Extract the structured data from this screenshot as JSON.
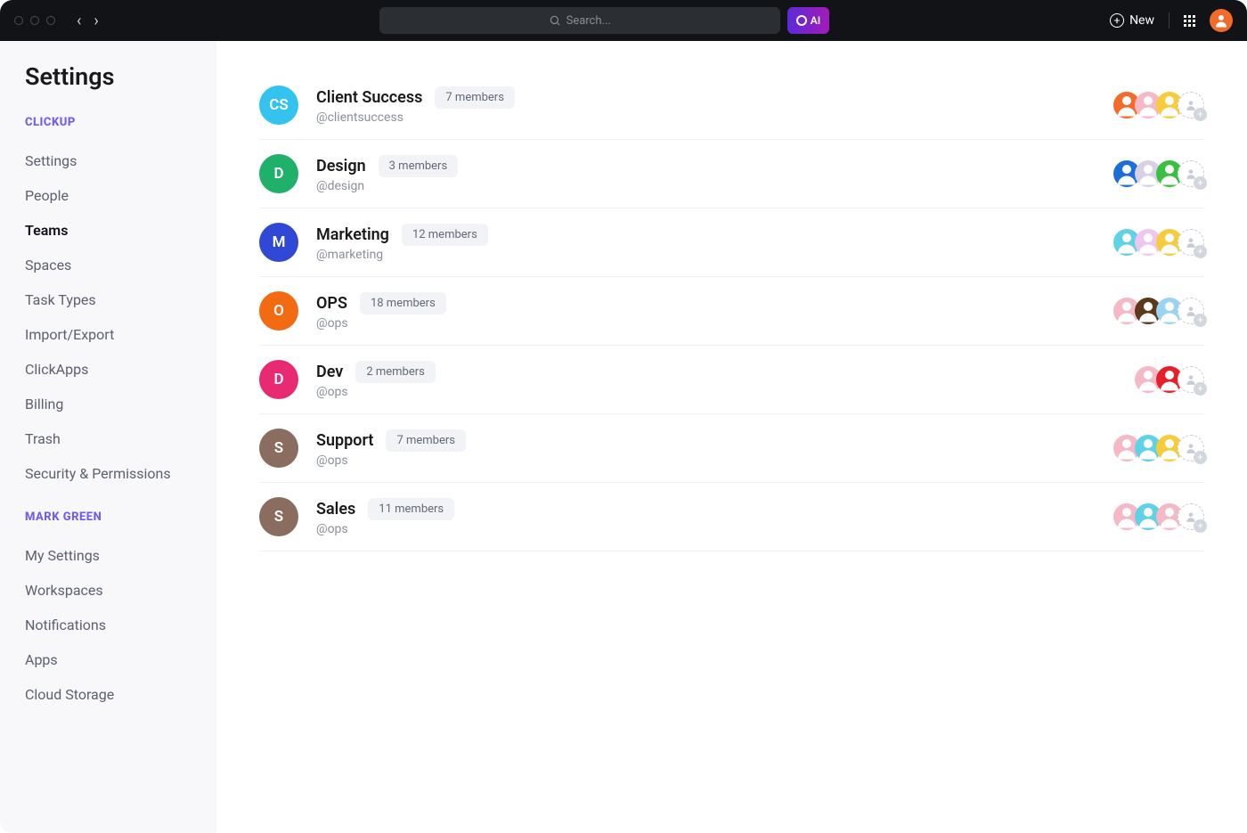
{
  "topbar": {
    "search_placeholder": "Search...",
    "ai_label": "AI",
    "new_label": "New",
    "user_avatar_color": "#f26b2a"
  },
  "sidebar": {
    "title": "Settings",
    "section1": "CLICKUP",
    "section2": "MARK GREEN",
    "items1": [
      {
        "label": "Settings",
        "active": false
      },
      {
        "label": "People",
        "active": false
      },
      {
        "label": "Teams",
        "active": true
      },
      {
        "label": "Spaces",
        "active": false
      },
      {
        "label": "Task Types",
        "active": false
      },
      {
        "label": "Import/Export",
        "active": false
      },
      {
        "label": "ClickApps",
        "active": false
      },
      {
        "label": "Billing",
        "active": false
      },
      {
        "label": "Trash",
        "active": false
      },
      {
        "label": "Security & Permissions",
        "active": false
      }
    ],
    "items2": [
      {
        "label": "My Settings",
        "active": false
      },
      {
        "label": "Workspaces",
        "active": false
      },
      {
        "label": "Notifications",
        "active": false
      },
      {
        "label": "Apps",
        "active": false
      },
      {
        "label": "Cloud Storage",
        "active": false
      }
    ]
  },
  "teams": [
    {
      "initials": "CS",
      "color": "#34c3ef",
      "name": "Client Success",
      "handle": "@clientsuccess",
      "members": "7 members",
      "avatars": [
        {
          "bg": "#f26b2a"
        },
        {
          "bg": "#f4b8c7"
        },
        {
          "bg": "#f6cc3d"
        }
      ]
    },
    {
      "initials": "D",
      "color": "#1fb069",
      "name": "Design",
      "handle": "@design",
      "members": "3 members",
      "avatars": [
        {
          "bg": "#1d6fd6"
        },
        {
          "bg": "#d9d0e6"
        },
        {
          "bg": "#3bbf40"
        }
      ]
    },
    {
      "initials": "M",
      "color": "#2f48d5",
      "name": "Marketing",
      "handle": "@marketing",
      "members": "12 members",
      "avatars": [
        {
          "bg": "#5fd2e6"
        },
        {
          "bg": "#eec6f0"
        },
        {
          "bg": "#f6cc3d"
        }
      ]
    },
    {
      "initials": "O",
      "color": "#f26b13",
      "name": "OPS",
      "handle": "@ops",
      "members": "18 members",
      "avatars": [
        {
          "bg": "#f4b8c7"
        },
        {
          "bg": "#5a3a1b"
        },
        {
          "bg": "#9bd4f0"
        }
      ]
    },
    {
      "initials": "D",
      "color": "#e82a72",
      "name": "Dev",
      "handle": "@ops",
      "members": "2 members",
      "avatars": [
        {
          "bg": "#f4b8c7"
        },
        {
          "bg": "#e61f2a"
        }
      ]
    },
    {
      "initials": "S",
      "color": "#8a6d5f",
      "name": "Support",
      "handle": "@ops",
      "members": "7 members",
      "avatars": [
        {
          "bg": "#f4b8c7"
        },
        {
          "bg": "#5fd2e6"
        },
        {
          "bg": "#f6cc3d"
        }
      ]
    },
    {
      "initials": "S",
      "color": "#8a6d5f",
      "name": "Sales",
      "handle": "@ops",
      "members": "11 members",
      "avatars": [
        {
          "bg": "#f4b8c7"
        },
        {
          "bg": "#5fd2e6"
        },
        {
          "bg": "#f4b8c7"
        }
      ]
    }
  ]
}
